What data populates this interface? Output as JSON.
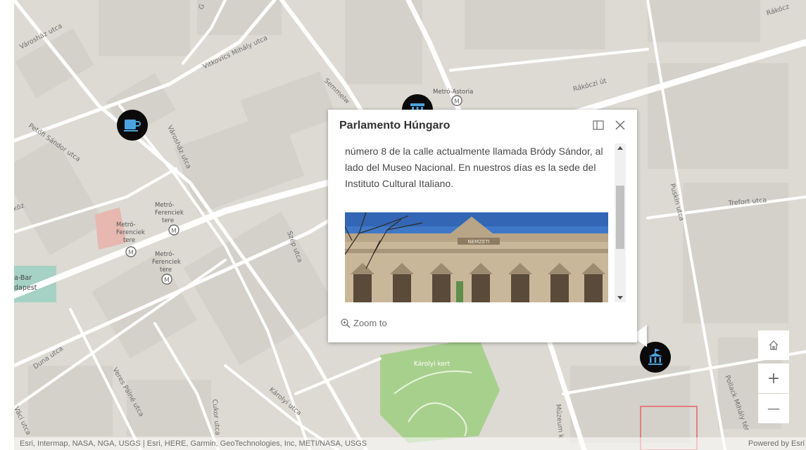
{
  "map": {
    "street_labels": {
      "varoshaz1": "Városház utca",
      "vitkovics": "Vitkovics Mihály utca",
      "semmelw": "Semmelw",
      "petofi": "Petőfi Sándor utca",
      "varoshaz2": "Városház utca",
      "koz": "köz",
      "rakoczi1": "Rákóczi út",
      "rakoczi2": "Rákócz",
      "szep": "Szép utca",
      "puskin": "Puskin utca",
      "trefort": "Trefort utca",
      "duna": "Duna utca",
      "veres": "Veres Pálné utca",
      "cukor": "Cukor utca",
      "karolyi": "Károlyi utca",
      "vaci": "Váci utca",
      "muzeum": "Múzeum k",
      "pollack": "Pollack Mihály tér",
      "g": "G"
    },
    "metro_labels": {
      "astoria": "Metró-Astoria",
      "ferenciek1": [
        "Metró-",
        "Ferenciek",
        "tere"
      ],
      "ferenciek2": [
        "Metró-",
        "Ferenciek",
        "tere"
      ],
      "ferenciek3": [
        "Metró-",
        "Ferenciek",
        "tere"
      ]
    },
    "place_labels": {
      "bar": [
        "a-Bar",
        "dapest"
      ],
      "park": "Károlyi kert"
    }
  },
  "poi_icons": [
    "coffee-cup-icon",
    "museum-icon",
    "museum-flag-icon"
  ],
  "popup": {
    "title": "Parlamento Húngaro",
    "dock_icon": "dock-icon",
    "close_icon": "close-icon",
    "body_text": "número 8 de la calle actualmente llamada Bródy Sándor, al lado del Museo Nacional. En nuestros días es la sede del Instituto Cultural Italiano.",
    "zoom_label": "Zoom to",
    "photo_sign": "NEMZETI"
  },
  "controls": {
    "home": "home-icon",
    "zoom_in": "+",
    "zoom_out": "—"
  },
  "attribution": {
    "sources": "Esri, Intermap, NASA, NGA, USGS | Esri, HERE, Garmin, GeoTechnologies, Inc, METI/NASA, USGS",
    "powered": "Powered by Esri"
  },
  "colors": {
    "land": "#dcdad3",
    "roads": "#ffffff",
    "buildings": "#d2d0c9",
    "park": "#a8d08d",
    "poi": "#0a0a0a",
    "poi_glyph": "#4aa3df"
  }
}
